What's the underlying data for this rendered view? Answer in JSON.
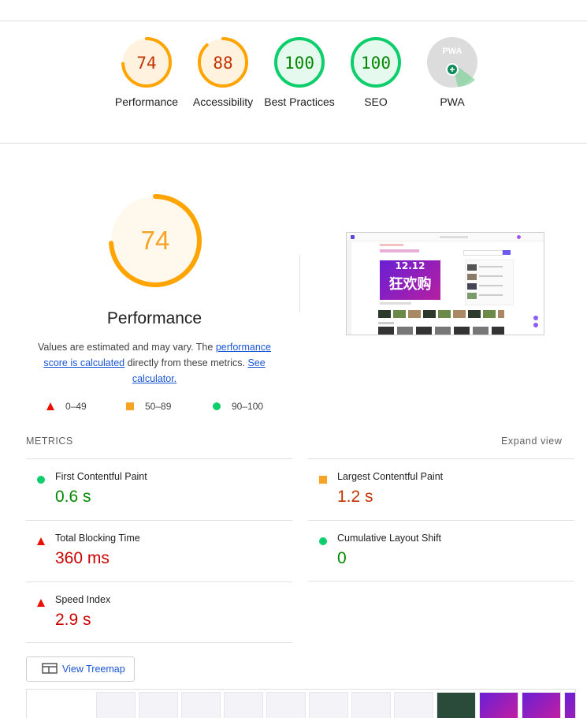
{
  "colors": {
    "pass": "#0cce6a",
    "pass_text": "#008800",
    "average": "#ffa400",
    "average_text": "#c33300",
    "fail": "#eb0f00",
    "fail_text": "#cc0000",
    "pwa_gray": "#9e9e9e",
    "link": "#1a55d6"
  },
  "summary": [
    {
      "score": "74",
      "label": "Performance",
      "level": "average"
    },
    {
      "score": "88",
      "label": "Accessibility",
      "level": "average"
    },
    {
      "score": "100",
      "label": "Best Practices",
      "level": "pass"
    },
    {
      "score": "100",
      "label": "SEO",
      "level": "pass"
    },
    {
      "score": "",
      "label": "PWA",
      "level": "pwa",
      "badge_text": "PWA"
    }
  ],
  "performance": {
    "score": "74",
    "title": "Performance",
    "desc_prefix": "Values are estimated and may vary. The ",
    "link_score": "performance score is calculated",
    "desc_mid": " directly from these metrics. ",
    "link_calc": "See calculator."
  },
  "legend": [
    {
      "range": "0–49",
      "shape": "triangle"
    },
    {
      "range": "50–89",
      "shape": "square"
    },
    {
      "range": "90–100",
      "shape": "circle"
    }
  ],
  "metrics_header": "METRICS",
  "expand_view": "Expand view",
  "metrics": [
    {
      "name": "First Contentful Paint",
      "value": "0.6 s",
      "level": "pass"
    },
    {
      "name": "Largest Contentful Paint",
      "value": "1.2 s",
      "level": "average"
    },
    {
      "name": "Total Blocking Time",
      "value": "360 ms",
      "level": "fail"
    },
    {
      "name": "Cumulative Layout Shift",
      "value": "0",
      "level": "pass"
    },
    {
      "name": "Speed Index",
      "value": "2.9 s",
      "level": "fail"
    }
  ],
  "screenshot": {
    "banner_text_1": "12.12",
    "banner_text_2": "狂欢购"
  },
  "treemap_button": "View Treemap"
}
